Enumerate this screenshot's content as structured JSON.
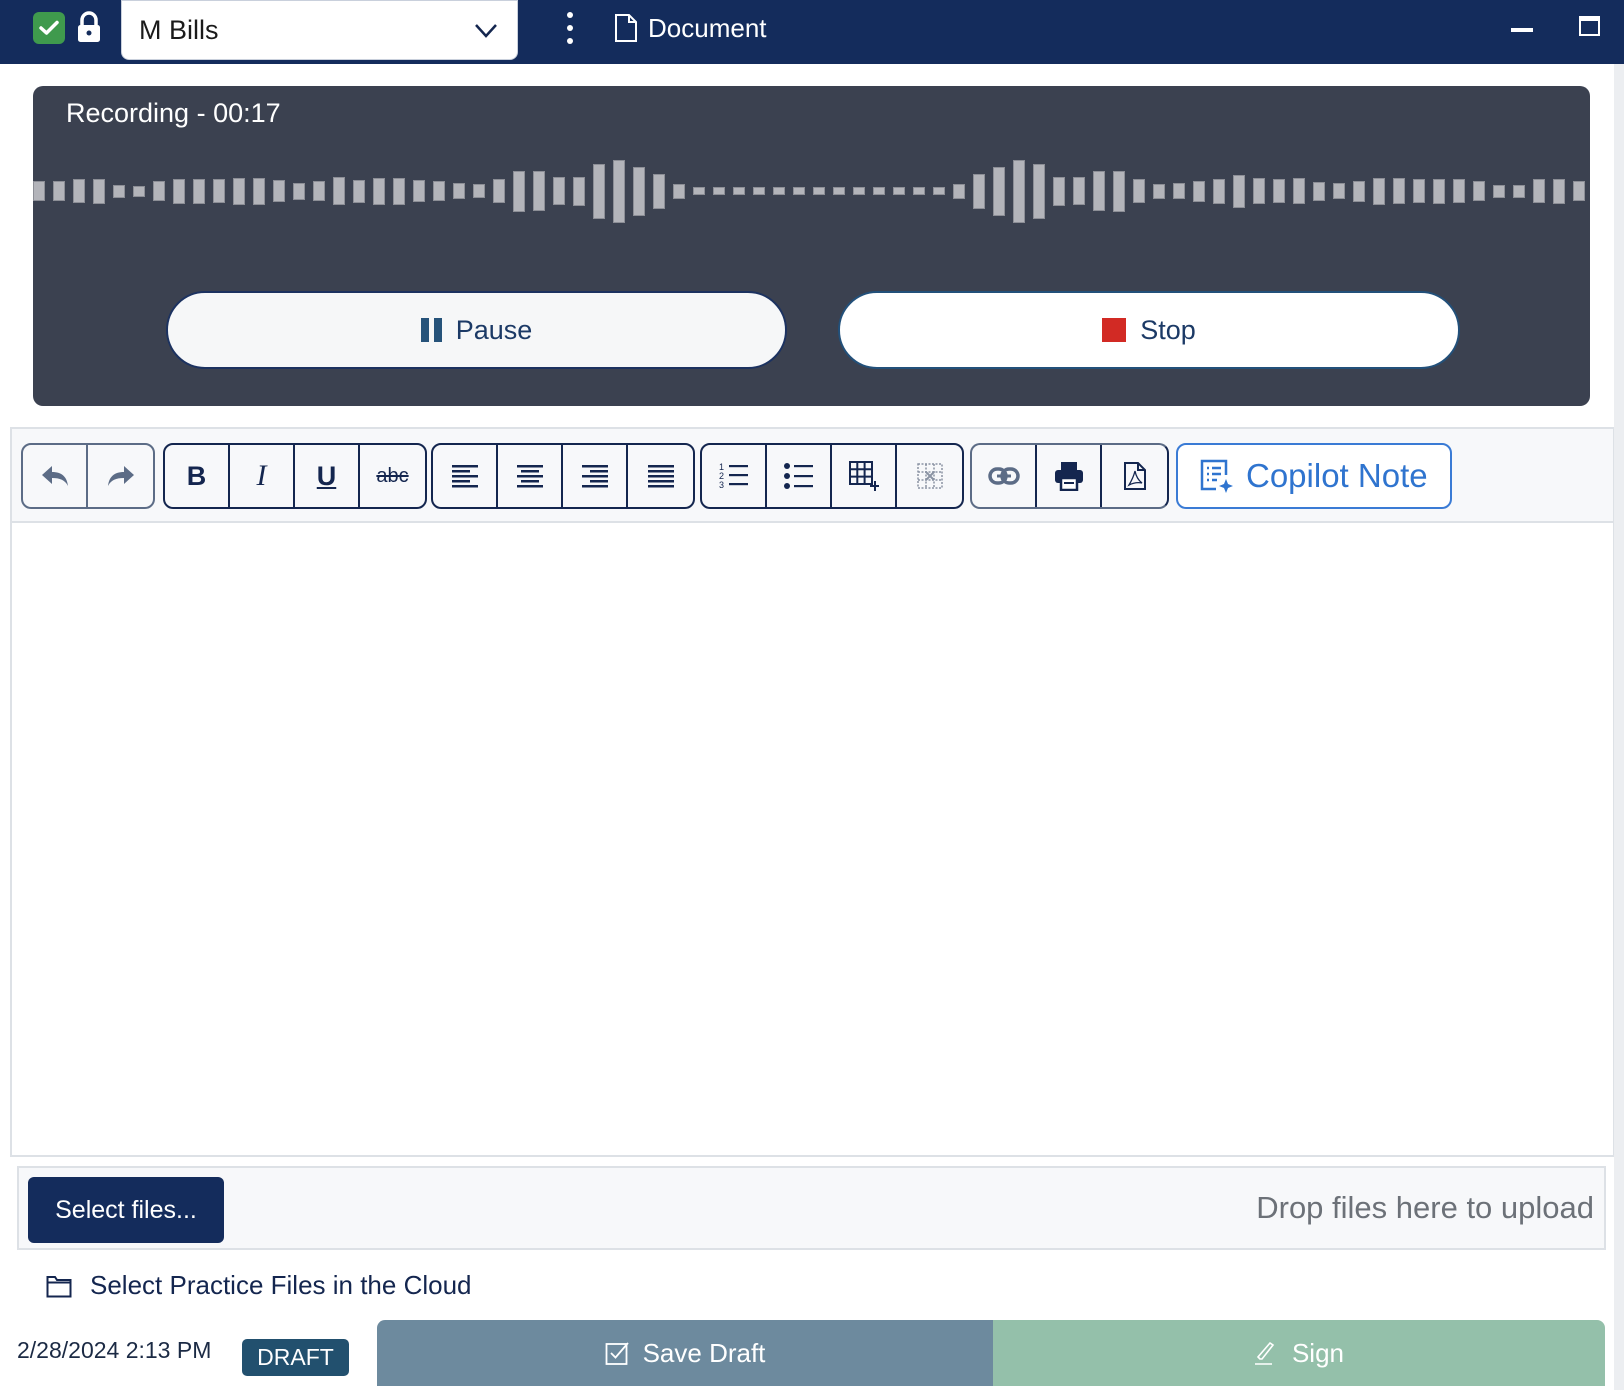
{
  "titlebar": {
    "patient_name": "M Bills",
    "tab_label": "Document",
    "icons": {
      "status": "check-icon",
      "lock": "lock-icon",
      "menu": "kebab-icon",
      "document": "document-icon"
    }
  },
  "recording": {
    "title": "Recording - 00:17",
    "waveform_levels": [
      0.32,
      0.32,
      0.38,
      0.4,
      0.2,
      0.17,
      0.32,
      0.4,
      0.4,
      0.38,
      0.43,
      0.43,
      0.35,
      0.27,
      0.32,
      0.44,
      0.37,
      0.43,
      0.43,
      0.35,
      0.32,
      0.25,
      0.22,
      0.38,
      0.65,
      0.63,
      0.44,
      0.46,
      0.87,
      1.0,
      0.78,
      0.55,
      0.24,
      0.12,
      0.13,
      0.12,
      0.12,
      0.12,
      0.12,
      0.12,
      0.12,
      0.12,
      0.12,
      0.12,
      0.13,
      0.12,
      0.24,
      0.55,
      0.78,
      1.0,
      0.87,
      0.46,
      0.44,
      0.63,
      0.65,
      0.38,
      0.24,
      0.26,
      0.34,
      0.4,
      0.52,
      0.41,
      0.38,
      0.41,
      0.3,
      0.26,
      0.34,
      0.43,
      0.41,
      0.38,
      0.4,
      0.38,
      0.32,
      0.2,
      0.2,
      0.38,
      0.4,
      0.32
    ],
    "pause_label": "Pause",
    "stop_label": "Stop",
    "colors": {
      "stop": "#d22a24",
      "panel": "#3b4150"
    }
  },
  "toolbar": {
    "groups": [
      {
        "items": [
          "undo-icon",
          "redo-icon"
        ]
      },
      {
        "items": [
          "bold-icon",
          "italic-icon",
          "underline-icon",
          "strikethrough-icon"
        ],
        "labels": [
          "B",
          "I",
          "U",
          "abc"
        ]
      },
      {
        "items": [
          "align-left-icon",
          "align-center-icon",
          "align-right-icon",
          "align-justify-icon"
        ]
      },
      {
        "items": [
          "ordered-list-icon",
          "bulleted-list-icon",
          "insert-table-icon",
          "delete-table-icon"
        ]
      },
      {
        "items": [
          "link-icon",
          "print-icon",
          "pdf-icon"
        ]
      }
    ],
    "copilot_label": "Copilot Note",
    "copilot_color": "#2f74cf"
  },
  "upload": {
    "select_label": "Select files...",
    "drop_hint": "Drop files here to upload",
    "cloud_label": "Select Practice Files in the Cloud"
  },
  "footer": {
    "timestamp": "2/28/2024 2:13 PM",
    "status_badge": "DRAFT",
    "save_draft_label": "Save Draft",
    "sign_label": "Sign"
  }
}
